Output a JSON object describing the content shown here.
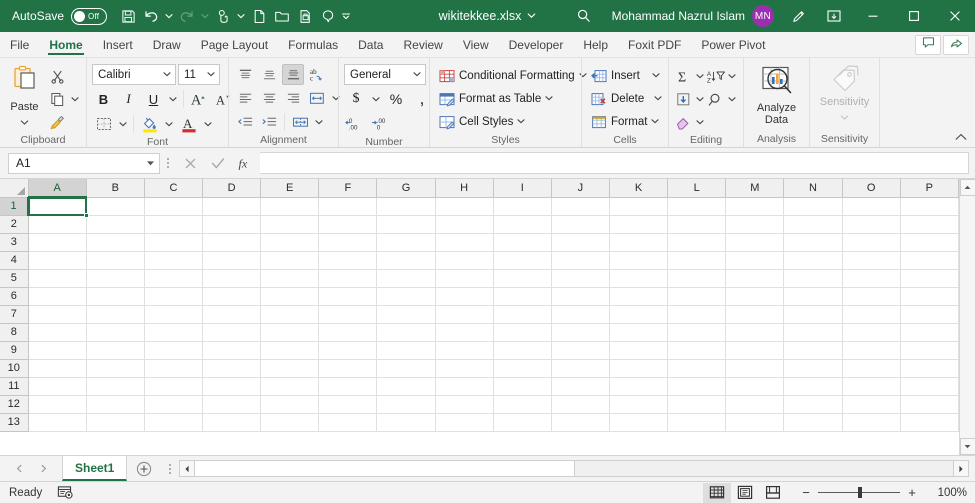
{
  "titlebar": {
    "autosave_label": "AutoSave",
    "autosave_state": "Off",
    "document_name": "wikitekkee.xlsx",
    "account_name": "Mohammad Nazrul Islam",
    "account_initials": "MN",
    "quick_access": [
      {
        "name": "save-icon",
        "label": "Save",
        "disabled": false
      },
      {
        "name": "undo-icon",
        "label": "Undo",
        "disabled": false
      },
      {
        "name": "redo-icon",
        "label": "Redo",
        "disabled": true
      },
      {
        "name": "touch-mode-icon",
        "label": "Touch/Mouse Mode",
        "disabled": false
      },
      {
        "name": "new-file-icon",
        "label": "New",
        "disabled": false
      },
      {
        "name": "open-folder-icon",
        "label": "Open",
        "disabled": false
      },
      {
        "name": "quick-print-icon",
        "label": "Quick Print",
        "disabled": false
      },
      {
        "name": "spelling-icon",
        "label": "Spelling",
        "disabled": false
      },
      {
        "name": "customize-qat-icon",
        "label": "Customize Quick Access Toolbar",
        "disabled": false
      }
    ],
    "search_icon": "search-icon",
    "pen_icon": "draw-pen-icon",
    "ribbon_display_icon": "ribbon-display-options-icon",
    "minimize": "minimize-icon",
    "maximize": "maximize-icon",
    "close": "close-icon",
    "accent_green": "#217346",
    "avatar_color": "#9b2fae"
  },
  "ribbon_tabs": [
    {
      "label": "File",
      "active": false
    },
    {
      "label": "Home",
      "active": true
    },
    {
      "label": "Insert",
      "active": false
    },
    {
      "label": "Draw",
      "active": false
    },
    {
      "label": "Page Layout",
      "active": false
    },
    {
      "label": "Formulas",
      "active": false
    },
    {
      "label": "Data",
      "active": false
    },
    {
      "label": "Review",
      "active": false
    },
    {
      "label": "View",
      "active": false
    },
    {
      "label": "Developer",
      "active": false
    },
    {
      "label": "Help",
      "active": false
    },
    {
      "label": "Foxit PDF",
      "active": false
    },
    {
      "label": "Power Pivot",
      "active": false
    }
  ],
  "tabstrip_right": [
    {
      "name": "comments-button",
      "label": "Comments"
    },
    {
      "name": "share-button",
      "label": "Share"
    }
  ],
  "ribbon": {
    "clipboard": {
      "title": "Clipboard",
      "paste_label": "Paste",
      "cut_label": "Cut",
      "copy_label": "Copy",
      "format_painter_label": "Format Painter"
    },
    "font": {
      "title": "Font",
      "font_family": "Calibri",
      "font_size": "11",
      "bold": "B",
      "italic": "I",
      "underline": "U",
      "grow_font": "A",
      "shrink_font": "A",
      "borders_label": "Borders",
      "fill_color_label": "Fill Color",
      "font_color_label": "Font Color"
    },
    "alignment": {
      "title": "Alignment",
      "top_align": "Top Align",
      "middle_align": "Middle Align",
      "bottom_align": "Bottom Align",
      "orientation": "Orientation",
      "align_left": "Align Left",
      "center": "Center",
      "align_right": "Align Right",
      "wrap_text": "Wrap Text",
      "decrease_indent": "Decrease Indent",
      "increase_indent": "Increase Indent",
      "merge_center": "Merge & Center"
    },
    "number": {
      "title": "Number",
      "format": "General",
      "accounting": "$",
      "percent": "%",
      "comma": ",",
      "increase_decimal": "Increase Decimal",
      "decrease_decimal": "Decrease Decimal"
    },
    "styles": {
      "title": "Styles",
      "items": [
        {
          "label": "Conditional Formatting",
          "icon": "conditional-formatting-icon"
        },
        {
          "label": "Format as Table",
          "icon": "format-as-table-icon"
        },
        {
          "label": "Cell Styles",
          "icon": "cell-styles-icon"
        }
      ]
    },
    "cells": {
      "title": "Cells",
      "items": [
        {
          "label": "Insert",
          "icon": "insert-cells-icon"
        },
        {
          "label": "Delete",
          "icon": "delete-cells-icon"
        },
        {
          "label": "Format",
          "icon": "format-cells-icon"
        }
      ]
    },
    "editing": {
      "title": "Editing",
      "autosum": "AutoSum",
      "sort_filter": "Sort & Filter",
      "fill": "Fill",
      "find_select": "Find & Select",
      "clear": "Clear"
    },
    "analysis": {
      "title": "Analysis",
      "button_line1": "Analyze",
      "button_line2": "Data"
    },
    "sensitivity": {
      "title": "Sensitivity",
      "button_label": "Sensitivity",
      "disabled": true
    },
    "collapse_icon": "chevron-up-icon"
  },
  "formula_bar": {
    "name_box_value": "A1",
    "cancel_icon": "cancel-x-icon",
    "enter_icon": "enter-check-icon",
    "insert_function_icon": "insert-function-fx-icon",
    "formula_value": "",
    "formula_placeholder": ""
  },
  "grid": {
    "columns": [
      "A",
      "B",
      "C",
      "D",
      "E",
      "F",
      "G",
      "H",
      "I",
      "J",
      "K",
      "L",
      "M",
      "N",
      "O",
      "P"
    ],
    "rows": [
      "1",
      "2",
      "3",
      "4",
      "5",
      "6",
      "7",
      "8",
      "9",
      "10",
      "11",
      "12",
      "13"
    ],
    "active_cell": "A1",
    "active_column": "A",
    "active_row": "1",
    "selection_color": "#217346",
    "cells": {}
  },
  "sheet_tabs": {
    "prev_icon": "previous-sheet-icon",
    "next_icon": "next-sheet-icon",
    "tabs": [
      {
        "label": "Sheet1",
        "active": true
      }
    ],
    "add_sheet_icon": "add-sheet-plus-icon"
  },
  "statusbar": {
    "status_text": "Ready",
    "accessibility_icon": "accessibility-checker-icon",
    "views": [
      {
        "name": "normal-view-button",
        "label": "Normal",
        "selected": true
      },
      {
        "name": "page-layout-view-button",
        "label": "Page Layout",
        "selected": false
      },
      {
        "name": "page-break-preview-button",
        "label": "Page Break Preview",
        "selected": false
      }
    ],
    "zoom_out": "−",
    "zoom_in": "+",
    "zoom_level": "100%"
  }
}
